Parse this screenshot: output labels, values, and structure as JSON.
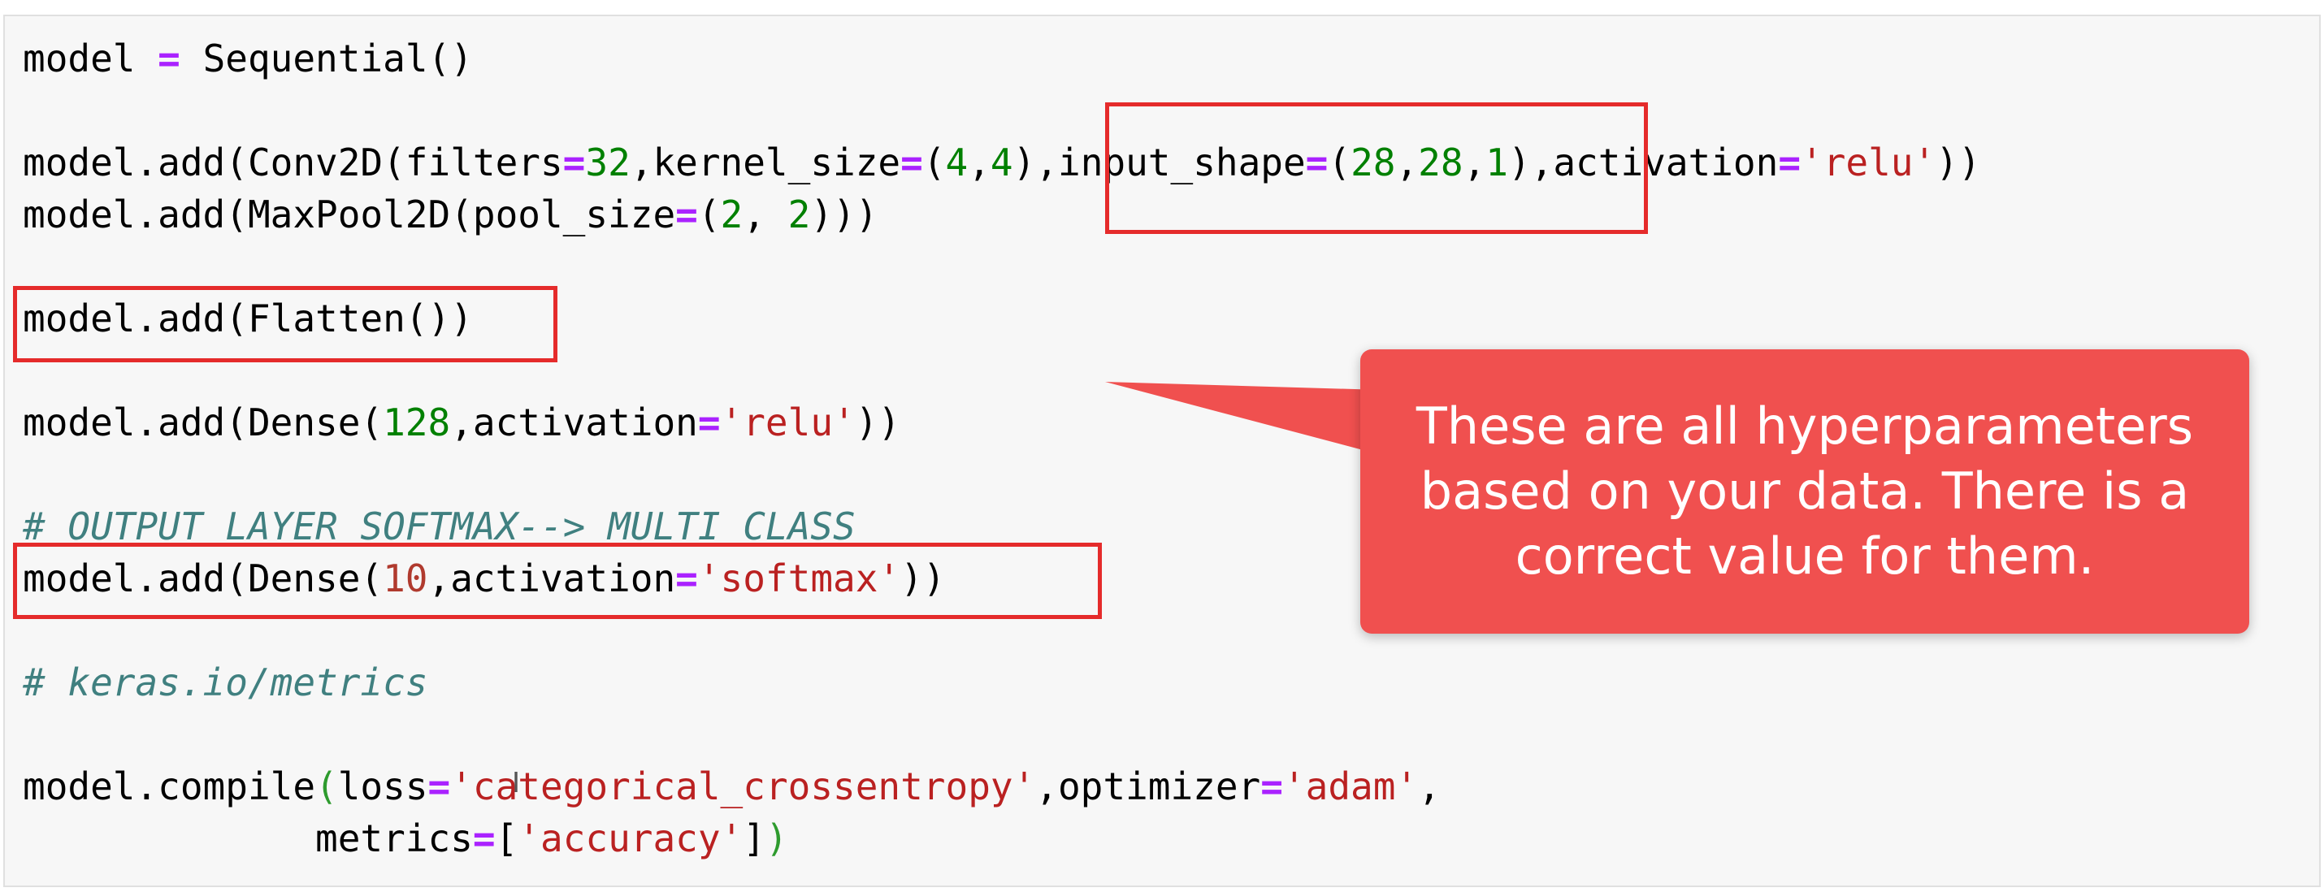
{
  "code": {
    "line1": {
      "a": "model ",
      "op": "=",
      "b": " Sequential()"
    },
    "line3": {
      "a": "model.add(Conv2D(filters",
      "op1": "=",
      "n1": "32",
      "b": ",kernel_size",
      "op2": "=",
      "c": "(",
      "n2": "4",
      "d": ",",
      "n3": "4",
      "e": ")",
      "f": ",input_shape",
      "op3": "=",
      "g": "(",
      "n4": "28",
      "h": ",",
      "n5": "28",
      "i": ",",
      "n6": "1",
      "j": ")",
      "k": ",activation",
      "op4": "=",
      "s1": "'relu'",
      "l": "))"
    },
    "line4": {
      "a": "model.add(MaxPool2D(pool_size",
      "op": "=",
      "b": "(",
      "n1": "2",
      "c": ", ",
      "n2": "2",
      "d": ")))"
    },
    "line6": {
      "a": "model.add(Flatten())"
    },
    "line8": {
      "a": "model.add(Dense(",
      "n1": "128",
      "b": ",activation",
      "op": "=",
      "s1": "'relu'",
      "c": "))"
    },
    "line10": {
      "comment": "# OUTPUT LAYER SOFTMAX--> MULTI CLASS"
    },
    "line11": {
      "a": "model.add(Dense(",
      "n1": "10",
      "b": ",activation",
      "op": "=",
      "s1": "'softmax'",
      "c": "))"
    },
    "line13": {
      "comment": "# keras.io/metrics"
    },
    "line15": {
      "a": "model.compile",
      "p": "(",
      "b": "loss",
      "op1": "=",
      "s1": "'categorical_crossentropy'",
      "c": ",optimizer",
      "op2": "=",
      "s2": "'adam'",
      "d": ","
    },
    "line16": {
      "indent": "             ",
      "a": "metrics",
      "op": "=",
      "b": "[",
      "s1": "'accuracy'",
      "c": "]",
      "p": ")"
    }
  },
  "callout": {
    "line1": "These are all hyperparameters",
    "line2": "based on your data. There is a",
    "line3": "correct value for them."
  },
  "colors": {
    "callout_bg": "#f0504f",
    "highlight_border": "#e52b2b",
    "keyword_op": "#aa22ff",
    "number": "#008000",
    "string": "#ba2121",
    "comment": "#408080"
  }
}
